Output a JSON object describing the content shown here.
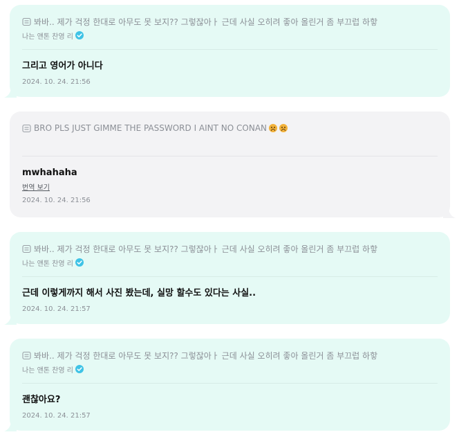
{
  "messages": [
    {
      "quote": "봐바.. 제가 걱정 한대로 아무도 못 보지?? 그렇잖아ㅏ 근데 사실 오히려 좋아 올린거 좀 부끄럽 하핳",
      "author": "나는 앤톤 찬영 리",
      "text": "그리고 영어가 아니다",
      "time": "2024. 10. 24. 21:56"
    },
    {
      "quote": "BRO PLS JUST GIMME THE PASSWORD I AINT NO CONAN",
      "text": "mwhahaha",
      "translate_label": "번역 보기",
      "time": "2024. 10. 24. 21:56"
    },
    {
      "quote": "봐바.. 제가 걱정 한대로 아무도 못 보지?? 그렇잖아ㅏ 근데 사실 오히려 좋아 올린거 좀 부끄럽 하핳",
      "author": "나는 앤톤 찬영 리",
      "text": "근데 이렇게까지 해서 사진 봤는데, 실망 할수도 있다는 사실..",
      "time": "2024. 10. 24. 21:57"
    },
    {
      "quote": "봐바.. 제가 걱정 한대로 아무도 못 보지?? 그렇잖아ㅏ 근데 사실 오히려 좋아 올린거 좀 부끄럽 하핳",
      "author": "나는 앤톤 찬영 리",
      "text": "괜찮아요?",
      "time": "2024. 10. 24. 21:57"
    }
  ],
  "icons": {
    "quote": "quote-document-icon",
    "verified": "verified-check-icon",
    "emoji": "frowning-face-emoji"
  },
  "colors": {
    "mint_bubble": "#e5faf5",
    "gray_bubble": "#f3f3f5",
    "verified": "#3fc3e6"
  }
}
